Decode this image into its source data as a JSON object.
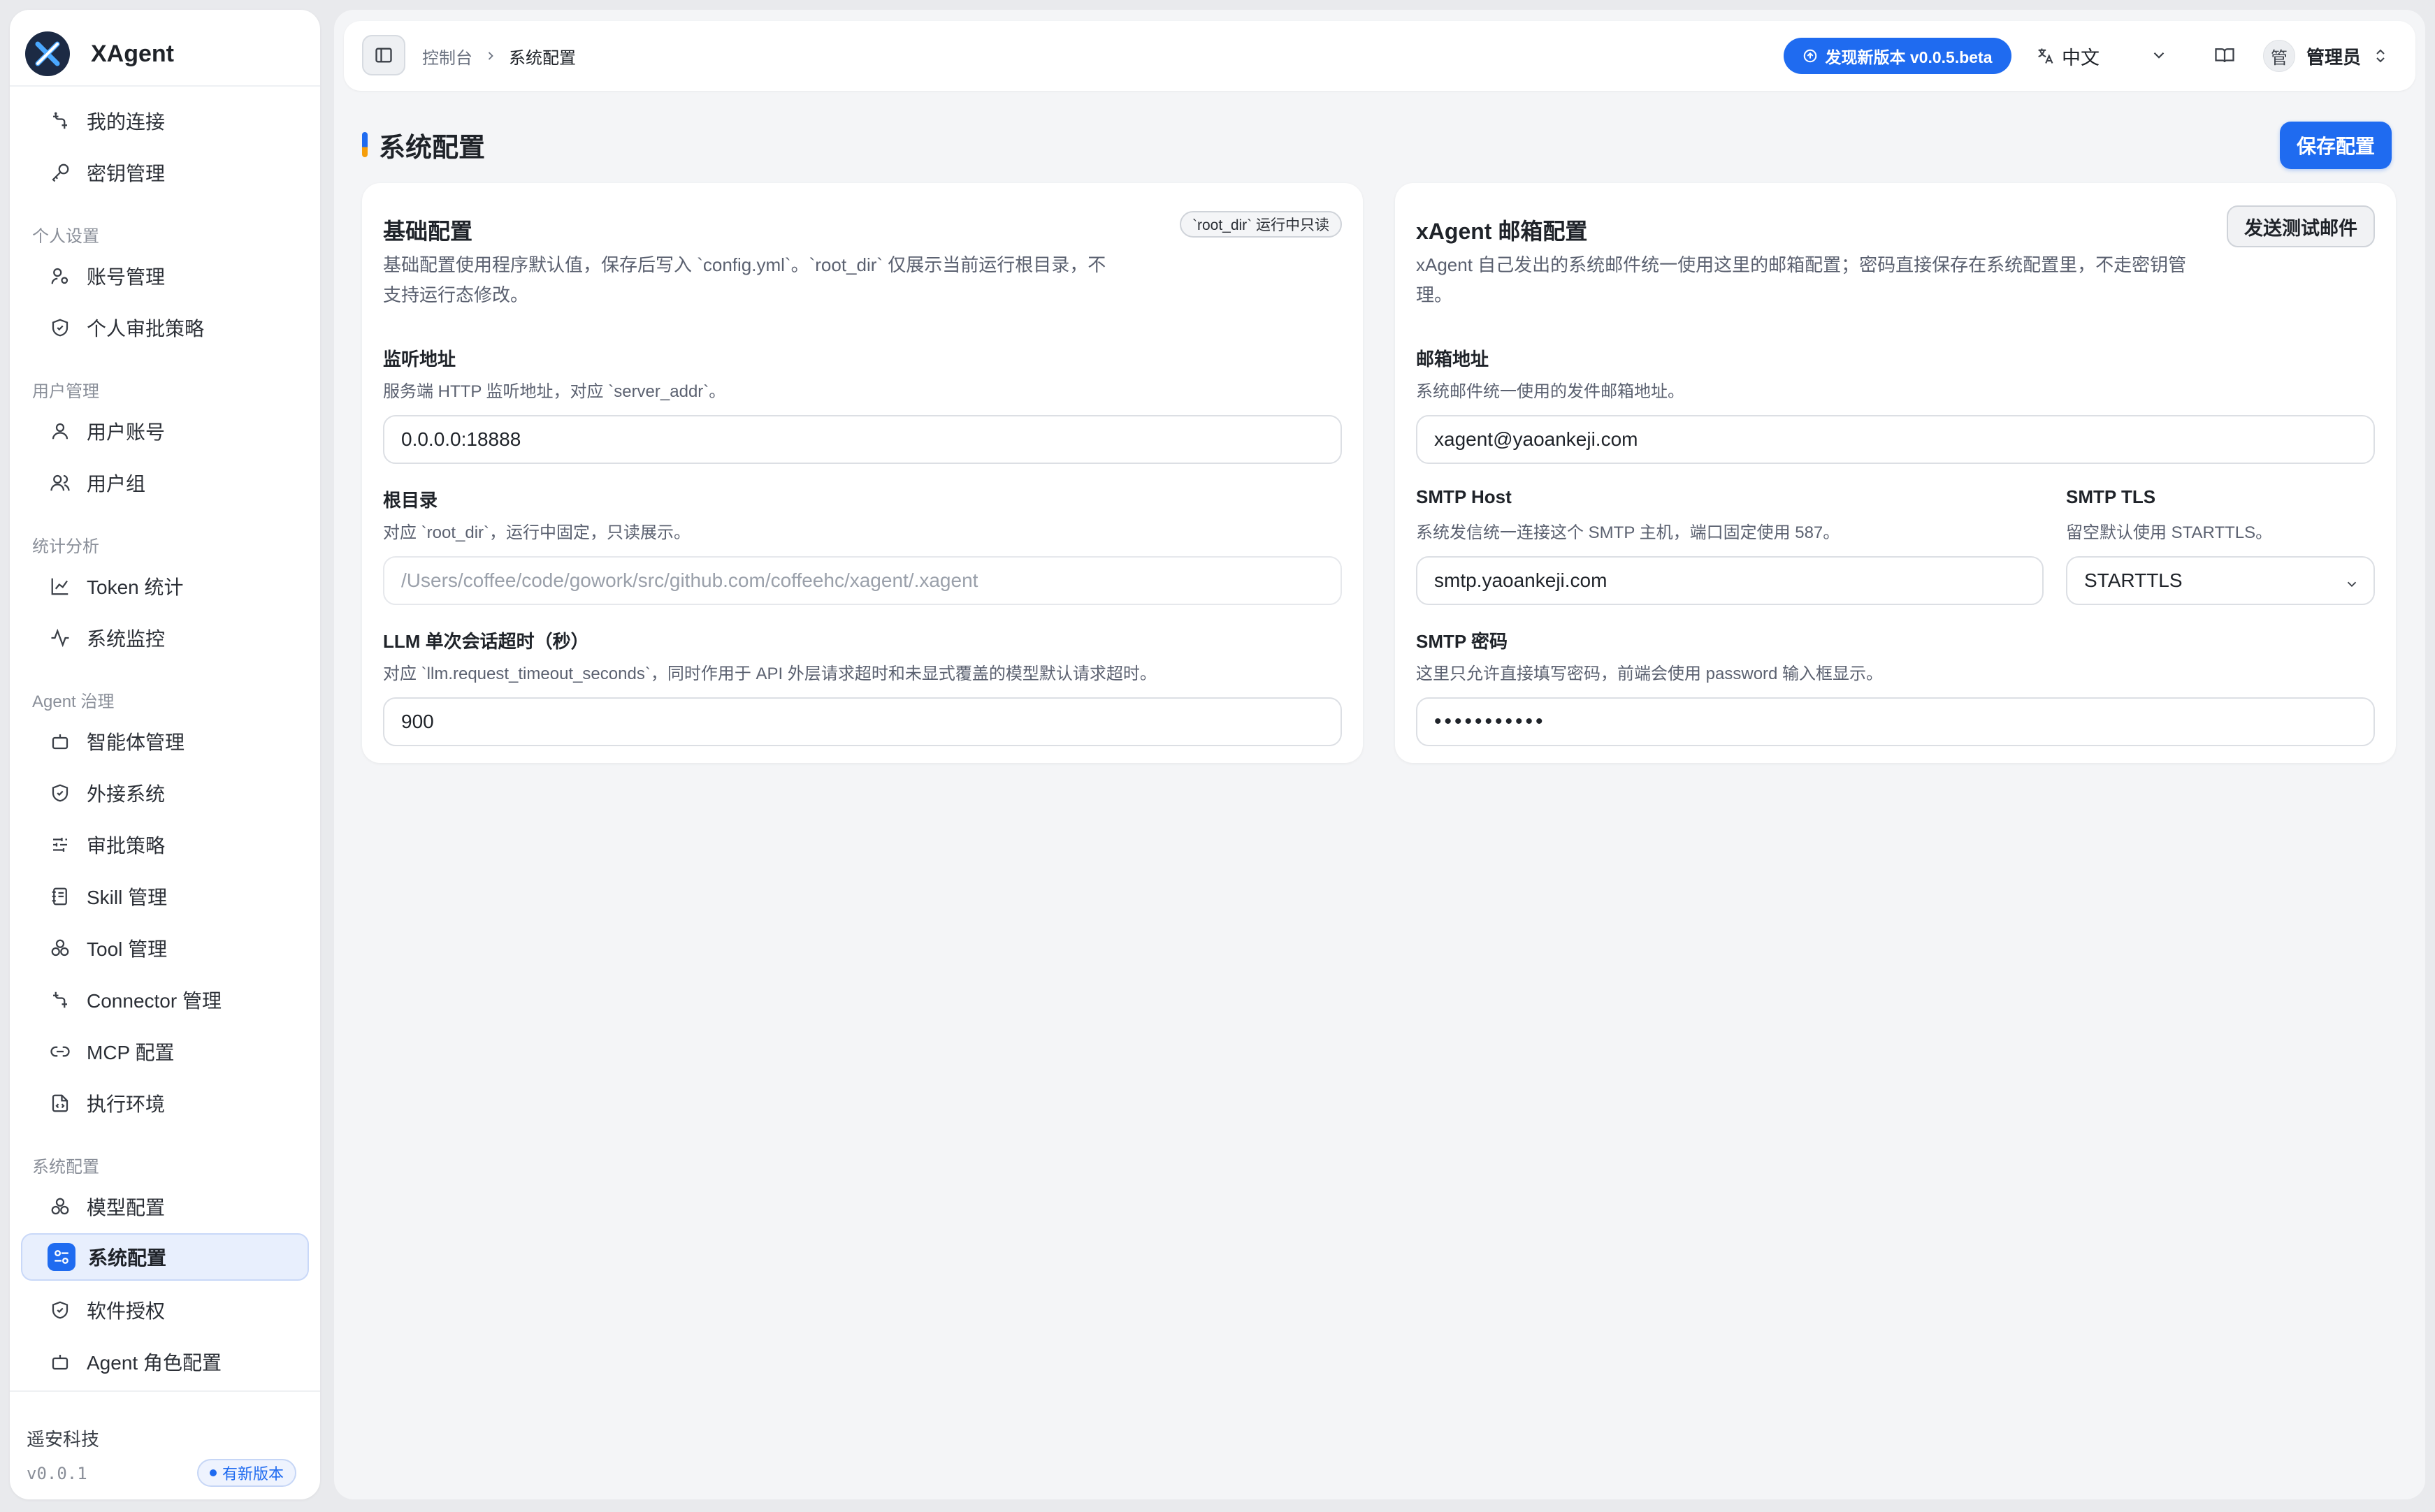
{
  "sidebar": {
    "brand": "XAgent",
    "items_top": [
      {
        "label": "我的连接",
        "icon": "connection-icon"
      },
      {
        "label": "密钥管理",
        "icon": "key-icon"
      }
    ],
    "sections": [
      {
        "title": "个人设置",
        "items": [
          {
            "label": "账号管理",
            "icon": "user-cog-icon"
          },
          {
            "label": "个人审批策略",
            "icon": "shield-icon"
          }
        ]
      },
      {
        "title": "用户管理",
        "items": [
          {
            "label": "用户账号",
            "icon": "user-icon"
          },
          {
            "label": "用户组",
            "icon": "users-icon"
          }
        ]
      },
      {
        "title": "统计分析",
        "items": [
          {
            "label": "Token 统计",
            "icon": "line-chart-icon"
          },
          {
            "label": "系统监控",
            "icon": "activity-icon"
          }
        ]
      },
      {
        "title": "Agent 治理",
        "items": [
          {
            "label": "智能体管理",
            "icon": "bot-icon"
          },
          {
            "label": "外接系统",
            "icon": "shield-icon"
          },
          {
            "label": "审批策略",
            "icon": "sliders-icon"
          },
          {
            "label": "Skill 管理",
            "icon": "notebook-icon"
          },
          {
            "label": "Tool 管理",
            "icon": "boxes-icon"
          },
          {
            "label": "Connector 管理",
            "icon": "connection-icon"
          },
          {
            "label": "MCP 配置",
            "icon": "link-icon"
          },
          {
            "label": "执行环境",
            "icon": "file-code-icon"
          }
        ]
      },
      {
        "title": "系统配置",
        "items": [
          {
            "label": "模型配置",
            "icon": "boxes-icon"
          },
          {
            "label": "系统配置",
            "icon": "settings-sliders-icon",
            "active": true
          },
          {
            "label": "软件授权",
            "icon": "shield-icon"
          },
          {
            "label": "Agent 角色配置",
            "icon": "bot-icon"
          }
        ]
      }
    ],
    "footer": {
      "org": "遥安科技",
      "version": "v0.0.1",
      "new_badge": "有新版本"
    }
  },
  "topbar": {
    "breadcrumb_parent": "控制台",
    "breadcrumb_current": "系统配置",
    "update_pill": "发现新版本 v0.0.5.beta",
    "language": "中文",
    "avatar_text": "管",
    "user_name": "管理员"
  },
  "page": {
    "title": "系统配置",
    "save_label": "保存配置"
  },
  "basic_card": {
    "title": "基础配置",
    "badge": "`root_dir` 运行中只读",
    "description": "基础配置使用程序默认值，保存后写入 `config.yml`。`root_dir` 仅展示当前运行根目录，不支持运行态修改。",
    "listen": {
      "label": "监听地址",
      "help": "服务端 HTTP 监听地址，对应 `server_addr`。",
      "value": "0.0.0.0:18888"
    },
    "root": {
      "label": "根目录",
      "help": "对应 `root_dir`，运行中固定，只读展示。",
      "value": "/Users/coffee/code/gowork/src/github.com/coffeehc/xagent/.xagent"
    },
    "timeout": {
      "label": "LLM 单次会话超时（秒）",
      "help": "对应 `llm.request_timeout_seconds`，同时作用于 API 外层请求超时和未显式覆盖的模型默认请求超时。",
      "value": "900"
    }
  },
  "mail_card": {
    "title": "xAgent 邮箱配置",
    "test_label": "发送测试邮件",
    "description": "xAgent 自己发出的系统邮件统一使用这里的邮箱配置；密码直接保存在系统配置里，不走密钥管理。",
    "email": {
      "label": "邮箱地址",
      "help": "系统邮件统一使用的发件邮箱地址。",
      "value": "xagent@yaoankeji.com"
    },
    "smtp_host": {
      "label": "SMTP Host",
      "help": "系统发信统一连接这个 SMTP 主机，端口固定使用 587。",
      "value": "smtp.yaoankeji.com"
    },
    "smtp_tls": {
      "label": "SMTP TLS",
      "help": "留空默认使用 STARTTLS。",
      "value": "STARTTLS"
    },
    "smtp_password": {
      "label": "SMTP 密码",
      "help": "这里只允许直接填写密码，前端会使用 password 输入框显示。",
      "value": "•••••••••••"
    }
  },
  "colors": {
    "accent": "#1f6bf0",
    "active_bg": "#e8effd",
    "warning": "#f59e0b"
  }
}
